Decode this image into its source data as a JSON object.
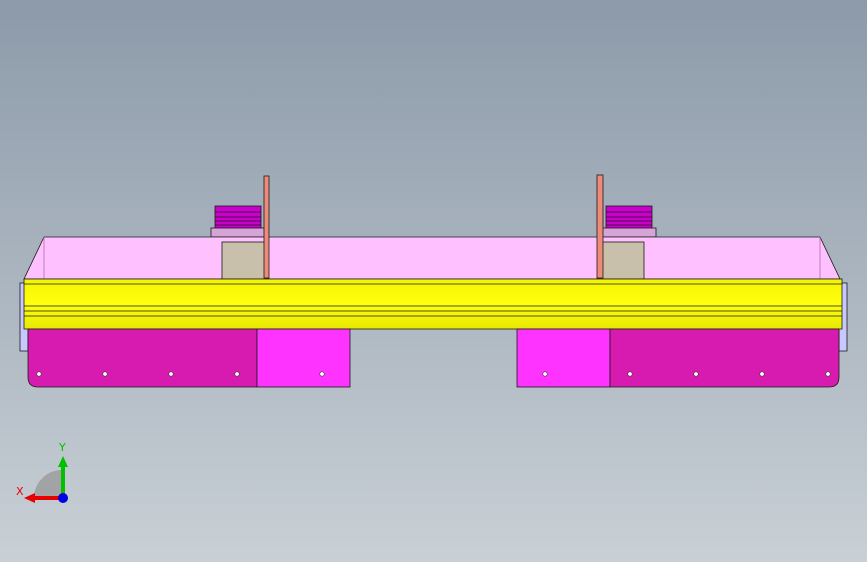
{
  "viewport": {
    "background_top": "#8c9aa9",
    "background_bottom": "#c9d0d6",
    "colors": {
      "top_plate": "#ffc0ff",
      "yellow_beam": "#ffff00",
      "magenta_bracket": "#d81bb0",
      "bright_magenta": "#ff33ff",
      "post": "#f08a78",
      "block_tan": "#c8c0aa",
      "clamp_purple": "#cc00cc",
      "edge": "#1a1a1a"
    }
  },
  "triad": {
    "x_label": "X",
    "y_label": "Y",
    "x_color": "#e60000",
    "y_color": "#00c000",
    "z_color": "#0000e6"
  }
}
